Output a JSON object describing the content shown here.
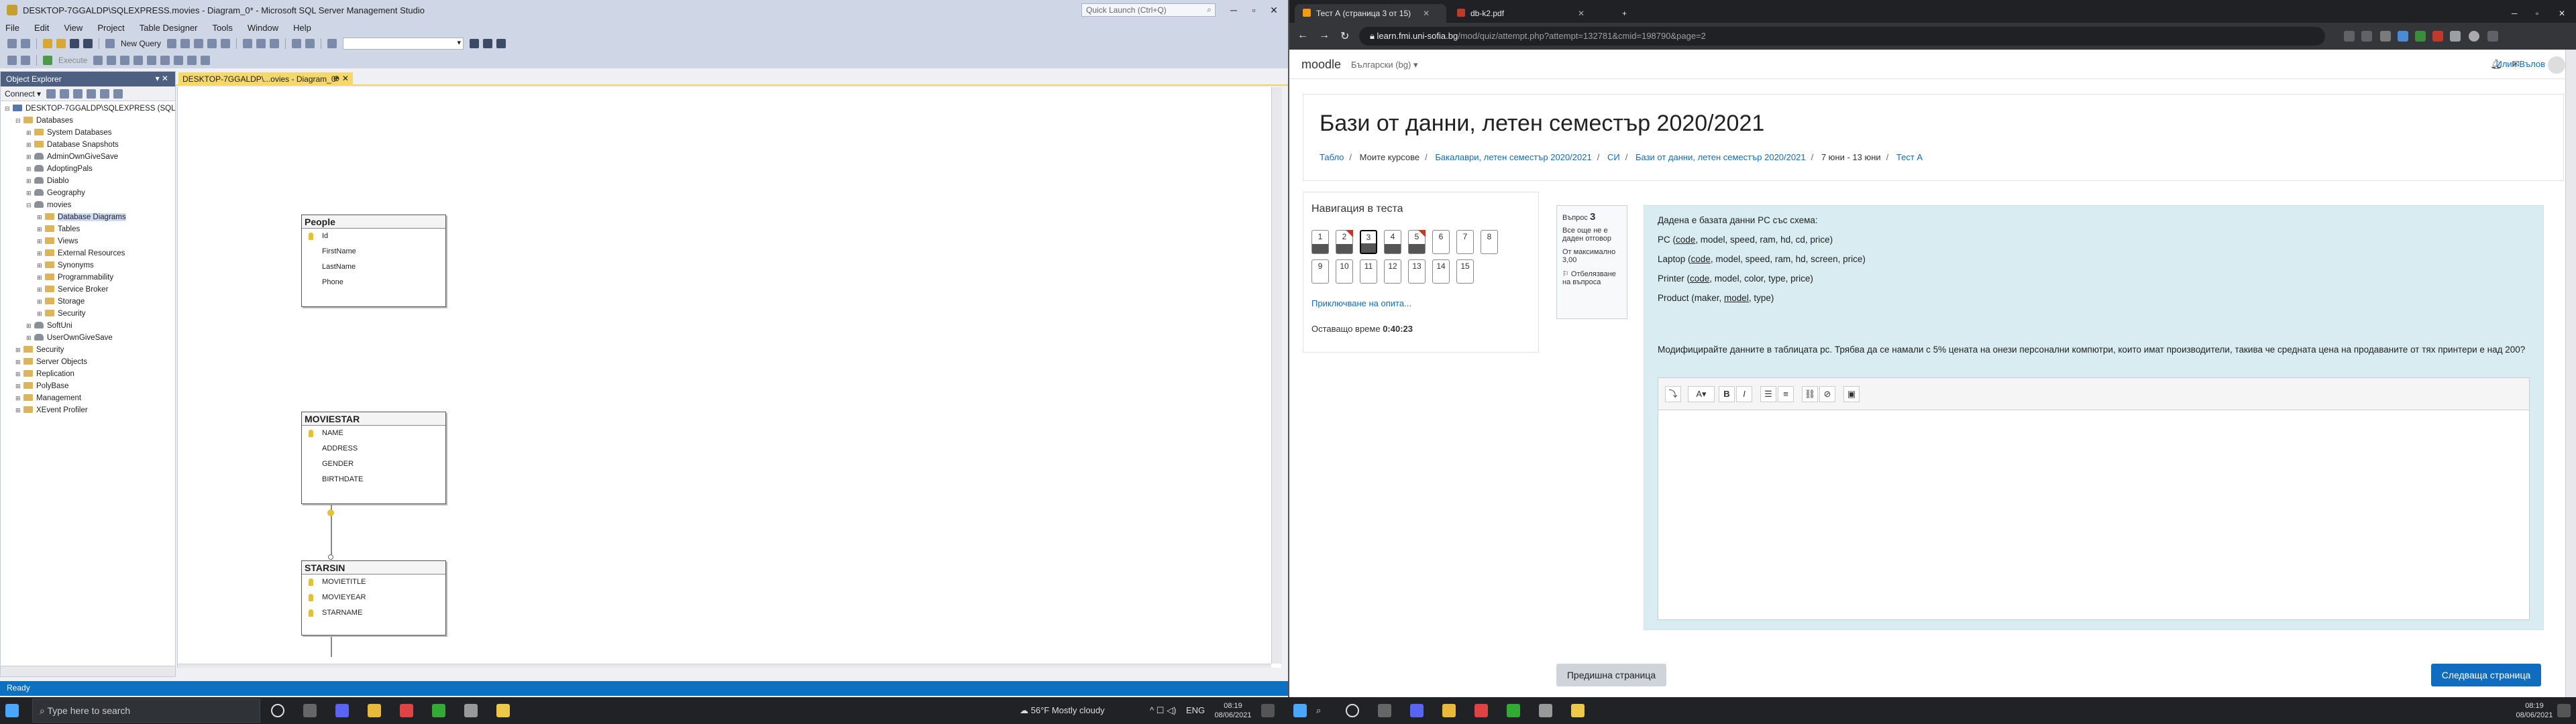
{
  "ssms": {
    "title": "DESKTOP-7GGALDP\\SQLEXPRESS.movies - Diagram_0* - Microsoft SQL Server Management Studio",
    "quick_launch": "Quick Launch (Ctrl+Q)",
    "menu": [
      "File",
      "Edit",
      "View",
      "Project",
      "Table Designer",
      "Tools",
      "Window",
      "Help"
    ],
    "toolbar": {
      "new_query": "New Query",
      "execute": "Execute"
    },
    "object_explorer": {
      "title": "Object Explorer",
      "pin": "▾ ✕",
      "connect": "Connect ▾",
      "tree": [
        {
          "label": "DESKTOP-7GGALDP\\SQLEXPRESS (SQL",
          "depth": 0,
          "kind": "srv",
          "ex": "⊟"
        },
        {
          "label": "Databases",
          "depth": 1,
          "kind": "f",
          "ex": "⊟"
        },
        {
          "label": "System Databases",
          "depth": 2,
          "kind": "f",
          "ex": "⊞"
        },
        {
          "label": "Database Snapshots",
          "depth": 2,
          "kind": "f",
          "ex": "⊞"
        },
        {
          "label": "AdminOwnGiveSave",
          "depth": 2,
          "kind": "db",
          "ex": "⊞"
        },
        {
          "label": "AdoptingPals",
          "depth": 2,
          "kind": "db",
          "ex": "⊞"
        },
        {
          "label": "Diablo",
          "depth": 2,
          "kind": "db",
          "ex": "⊞"
        },
        {
          "label": "Geography",
          "depth": 2,
          "kind": "db",
          "ex": "⊞"
        },
        {
          "label": "movies",
          "depth": 2,
          "kind": "db",
          "ex": "⊟"
        },
        {
          "label": "Database Diagrams",
          "depth": 3,
          "kind": "f",
          "ex": "⊞",
          "sel": true
        },
        {
          "label": "Tables",
          "depth": 3,
          "kind": "f",
          "ex": "⊞"
        },
        {
          "label": "Views",
          "depth": 3,
          "kind": "f",
          "ex": "⊞"
        },
        {
          "label": "External Resources",
          "depth": 3,
          "kind": "f",
          "ex": "⊞"
        },
        {
          "label": "Synonyms",
          "depth": 3,
          "kind": "f",
          "ex": "⊞"
        },
        {
          "label": "Programmability",
          "depth": 3,
          "kind": "f",
          "ex": "⊞"
        },
        {
          "label": "Service Broker",
          "depth": 3,
          "kind": "f",
          "ex": "⊞"
        },
        {
          "label": "Storage",
          "depth": 3,
          "kind": "f",
          "ex": "⊞"
        },
        {
          "label": "Security",
          "depth": 3,
          "kind": "f",
          "ex": "⊞"
        },
        {
          "label": "SoftUni",
          "depth": 2,
          "kind": "db",
          "ex": "⊞"
        },
        {
          "label": "UserOwnGiveSave",
          "depth": 2,
          "kind": "db",
          "ex": "⊞"
        },
        {
          "label": "Security",
          "depth": 1,
          "kind": "f",
          "ex": "⊞"
        },
        {
          "label": "Server Objects",
          "depth": 1,
          "kind": "f",
          "ex": "⊞"
        },
        {
          "label": "Replication",
          "depth": 1,
          "kind": "f",
          "ex": "⊞"
        },
        {
          "label": "PolyBase",
          "depth": 1,
          "kind": "f",
          "ex": "⊞"
        },
        {
          "label": "Management",
          "depth": 1,
          "kind": "f",
          "ex": "⊞"
        },
        {
          "label": "XEvent Profiler",
          "depth": 1,
          "kind": "f",
          "ex": "⊞"
        }
      ]
    },
    "doc_tab": "DESKTOP-7GGALDP\\...ovies - Diagram_0*",
    "tables": {
      "people": {
        "name": "People",
        "cols": [
          {
            "n": "Id",
            "k": true
          },
          {
            "n": "FirstName"
          },
          {
            "n": "LastName"
          },
          {
            "n": "Phone"
          }
        ]
      },
      "moviestar": {
        "name": "MOVIESTAR",
        "cols": [
          {
            "n": "NAME",
            "k": true
          },
          {
            "n": "ADDRESS"
          },
          {
            "n": "GENDER"
          },
          {
            "n": "BIRTHDATE"
          }
        ]
      },
      "starsin": {
        "name": "STARSIN",
        "cols": [
          {
            "n": "MOVIETITLE",
            "k": true
          },
          {
            "n": "MOVIEYEAR",
            "k": true
          },
          {
            "n": "STARNAME",
            "k": true
          }
        ]
      }
    },
    "status": "Ready"
  },
  "chrome": {
    "tab1": "Тест А (страница 3 от 15)",
    "tab2": "db-k2.pdf",
    "url_host": "learn.fmi.uni-sofia.bg",
    "url_path": "/mod/quiz/attempt.php?attempt=132781&cmid=198790&page=2"
  },
  "moodle": {
    "brand": "moodle",
    "lang": "Български (bg) ▾",
    "user": "Илия Вълов",
    "title": "Бази от данни, летен семестър 2020/2021",
    "breadcrumb": [
      "Табло",
      "Моите курсове",
      "Бакалаври, летен семестър 2020/2021",
      "СИ",
      "Бази от данни, летен семестър 2020/2021",
      "7 юни - 13 юни",
      "Тест А"
    ],
    "nav_title": "Навигация в теста",
    "questions": [
      {
        "n": "1",
        "answered": true
      },
      {
        "n": "2",
        "answered": true,
        "flag": true
      },
      {
        "n": "3",
        "answered": true,
        "current": true
      },
      {
        "n": "4",
        "answered": true
      },
      {
        "n": "5",
        "answered": true,
        "flag": true
      },
      {
        "n": "6"
      },
      {
        "n": "7"
      },
      {
        "n": "8"
      },
      {
        "n": "9"
      },
      {
        "n": "10"
      },
      {
        "n": "11"
      },
      {
        "n": "12"
      },
      {
        "n": "13"
      },
      {
        "n": "14"
      },
      {
        "n": "15"
      }
    ],
    "finish": "Приключване на опита...",
    "timer_label": "Оставащо време",
    "timer": "0:40:23",
    "qinfo": {
      "q_label": "Въпрос",
      "q_num": "3",
      "state": "Все още не е даден отговор",
      "max": "От максимално 3,00",
      "flag": "Отбелязване на въпроса"
    },
    "q_intro": "Дадена е базата данни PC със схема:",
    "schema": [
      {
        "pre": "PC (",
        "key": "code",
        "post": ", model, speed, ram, hd, cd, price)"
      },
      {
        "pre": "Laptop (",
        "key": "code",
        "post": ", model, speed, ram, hd, screen, price)"
      },
      {
        "pre": "Printer (",
        "key": "code",
        "post": ", model, color, type, price)"
      },
      {
        "pre": "Product (maker, ",
        "key": "model",
        "post": ", type)"
      }
    ],
    "question": "Модифицирайте данните в таблицата pc. Трябва да се намали с 5% цената на онези персонални компютри, които имат производители, такива че средната цена на продаваните от тях принтери е над 200?",
    "prev": "Предишна страница",
    "next": "Следваща страница"
  },
  "taskbar": {
    "search": "Type here to search",
    "weather": "56°F  Mostly cloudy",
    "lang": "ENG",
    "time": "08:19",
    "date": "08/06/2021"
  }
}
